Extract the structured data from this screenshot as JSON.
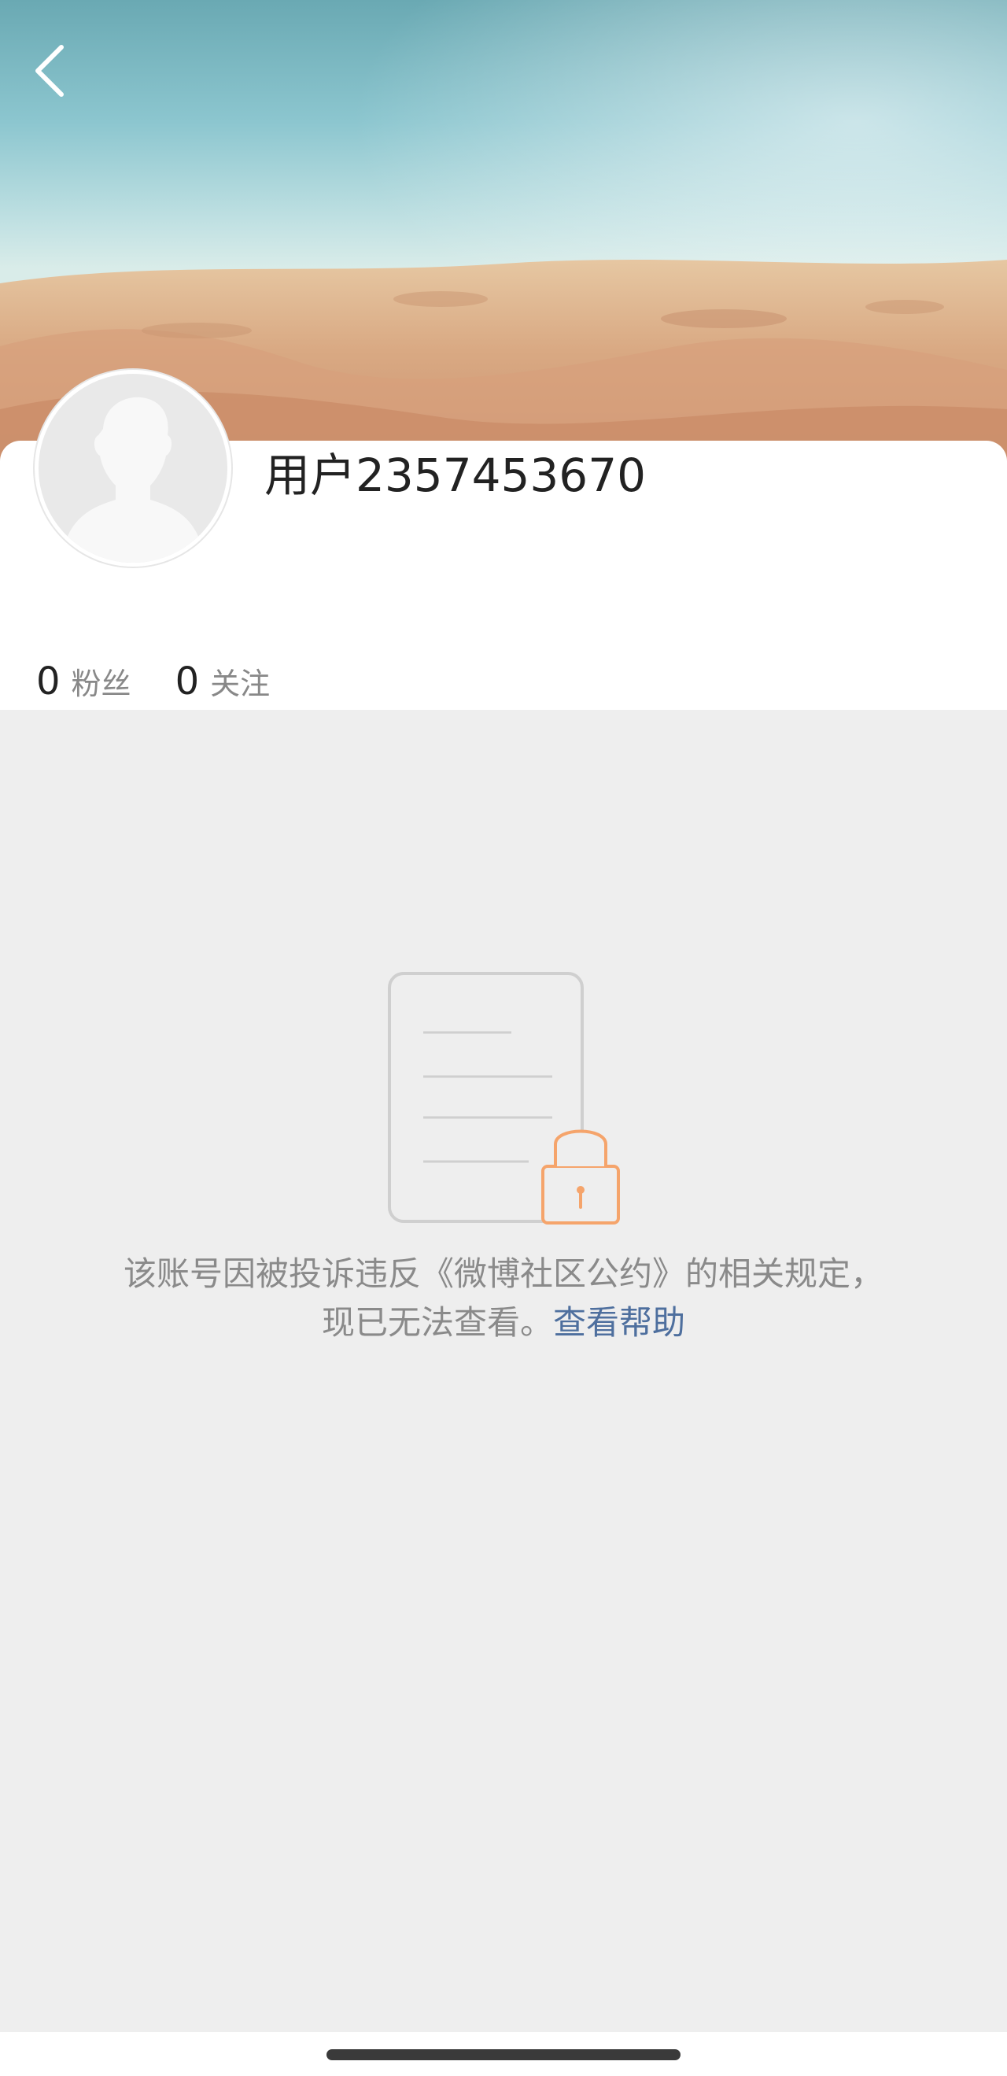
{
  "header": {
    "back_icon": "chevron-left-icon"
  },
  "profile": {
    "username": "用户2357453670",
    "avatar_icon": "default-avatar-icon",
    "stats": [
      {
        "count": "0",
        "label": "粉丝"
      },
      {
        "count": "0",
        "label": "关注"
      }
    ]
  },
  "notice": {
    "illustration_icon": "locked-document-icon",
    "message": "该账号因被投诉违反《微博社区公约》的相关规定，现已无法查看。",
    "help_link": "查看帮助"
  },
  "colors": {
    "background": "#eeeeee",
    "card": "#ffffff",
    "link": "#4e6f9e",
    "lock_accent": "#f5a46b",
    "muted_text": "#8a8a8a"
  }
}
